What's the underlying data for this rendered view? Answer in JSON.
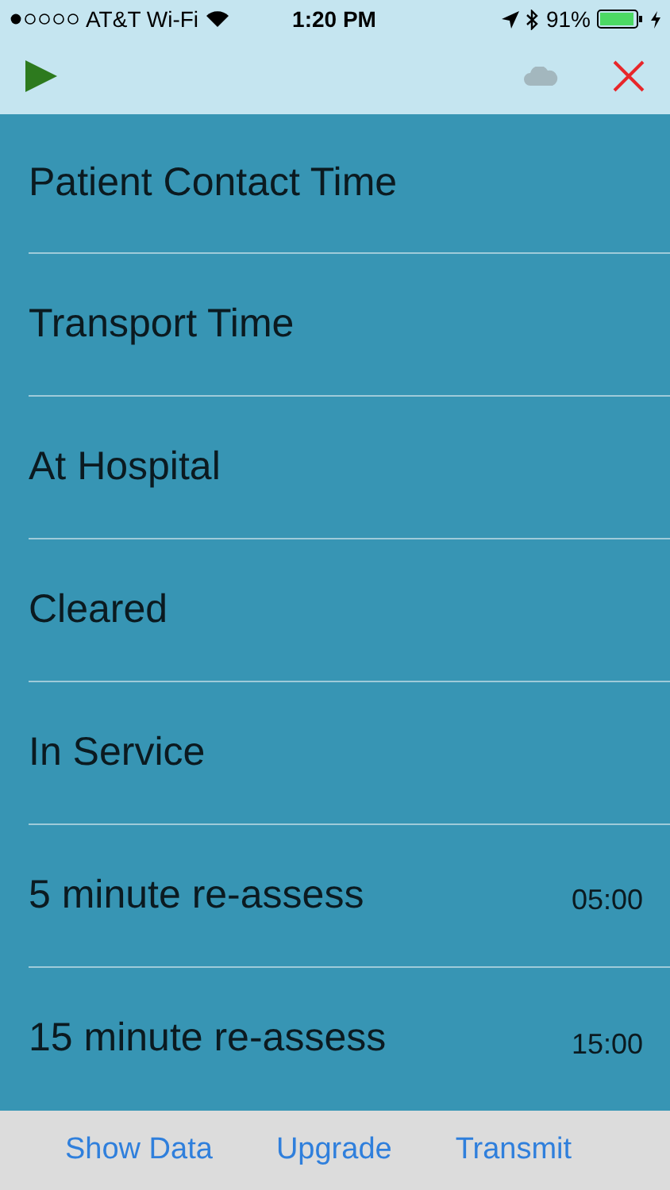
{
  "status_bar": {
    "carrier": "AT&T Wi-Fi",
    "time": "1:20 PM",
    "battery": "91%"
  },
  "rows": [
    {
      "label": "Patient Contact Time"
    },
    {
      "label": "Transport Time"
    },
    {
      "label": "At Hospital"
    },
    {
      "label": "Cleared"
    },
    {
      "label": "In Service"
    },
    {
      "label": "5 minute re-assess",
      "timer": "05:00"
    },
    {
      "label": "15 minute re-assess",
      "timer": "15:00"
    }
  ],
  "footer": [
    "Show Data",
    "Upgrade",
    "Transmit"
  ]
}
